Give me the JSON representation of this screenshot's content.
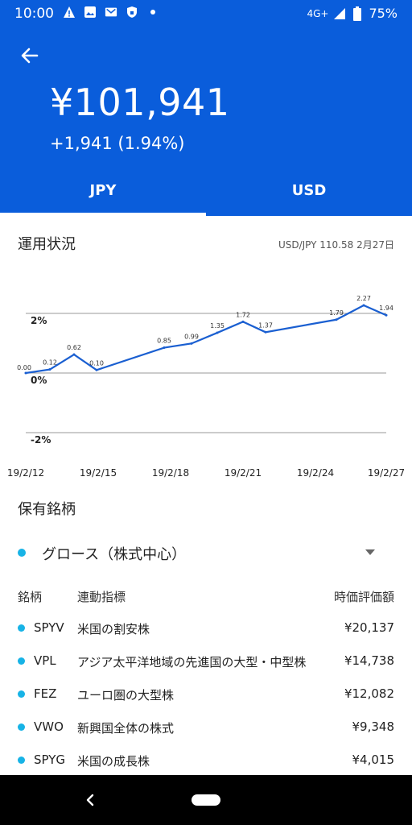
{
  "status_bar": {
    "time": "10:00",
    "left_icons": [
      "alert-icon",
      "image-icon",
      "gmail-icon",
      "lock-icon",
      "dot-icon"
    ],
    "network": "4G+",
    "battery": "75%"
  },
  "header": {
    "amount": "¥101,941",
    "change": "+1,941 (1.94%)",
    "color": "#0a5ddb"
  },
  "tabs": [
    {
      "label": "JPY",
      "active": true
    },
    {
      "label": "USD",
      "active": false
    }
  ],
  "performance": {
    "title": "運用状況",
    "rate": "USD/JPY 110.58 2月27日"
  },
  "chart_data": {
    "type": "line",
    "x": [
      "19/2/12",
      "19/2/13",
      "19/2/14",
      "19/2/15",
      "19/2/18",
      "19/2/19",
      "19/2/20",
      "19/2/21",
      "19/2/22",
      "19/2/25",
      "19/2/26",
      "19/2/27"
    ],
    "values": [
      0.0,
      0.12,
      0.62,
      0.1,
      0.85,
      0.99,
      1.35,
      1.72,
      1.37,
      1.79,
      2.27,
      1.94
    ],
    "data_labels": [
      "0.00",
      "0.12",
      "0.62",
      "0.10",
      "0.85",
      "0.99",
      "1.35",
      "1.72",
      "1.37",
      "1.79",
      "2.27",
      "1.94"
    ],
    "x_tick_labels": [
      "19/2/12",
      "19/2/15",
      "19/2/18",
      "19/2/21",
      "19/2/24",
      "19/2/27"
    ],
    "y_tick_labels": [
      "2%",
      "0%",
      "-2%"
    ],
    "y_ticks": [
      2,
      0,
      -2
    ],
    "ylim": [
      -2,
      2
    ],
    "line_color": "#1a5fd1",
    "grid": true
  },
  "holdings": {
    "title": "保有銘柄",
    "selected_fund": "グロース（株式中心）",
    "columns": [
      "銘柄",
      "連動指標",
      "時価評価額"
    ],
    "rows": [
      {
        "ticker": "SPYV",
        "index": "米国の割安株",
        "value": "¥20,137"
      },
      {
        "ticker": "VPL",
        "index": "アジア太平洋地域の先進国の大型・中型株",
        "value": "¥14,738"
      },
      {
        "ticker": "FEZ",
        "index": "ユーロ圏の大型株",
        "value": "¥12,082"
      },
      {
        "ticker": "VWO",
        "index": "新興国全体の株式",
        "value": "¥9,348"
      },
      {
        "ticker": "SPYG",
        "index": "米国の成長株",
        "value": "¥4,015"
      }
    ],
    "dot_color": "#17b3e6"
  }
}
